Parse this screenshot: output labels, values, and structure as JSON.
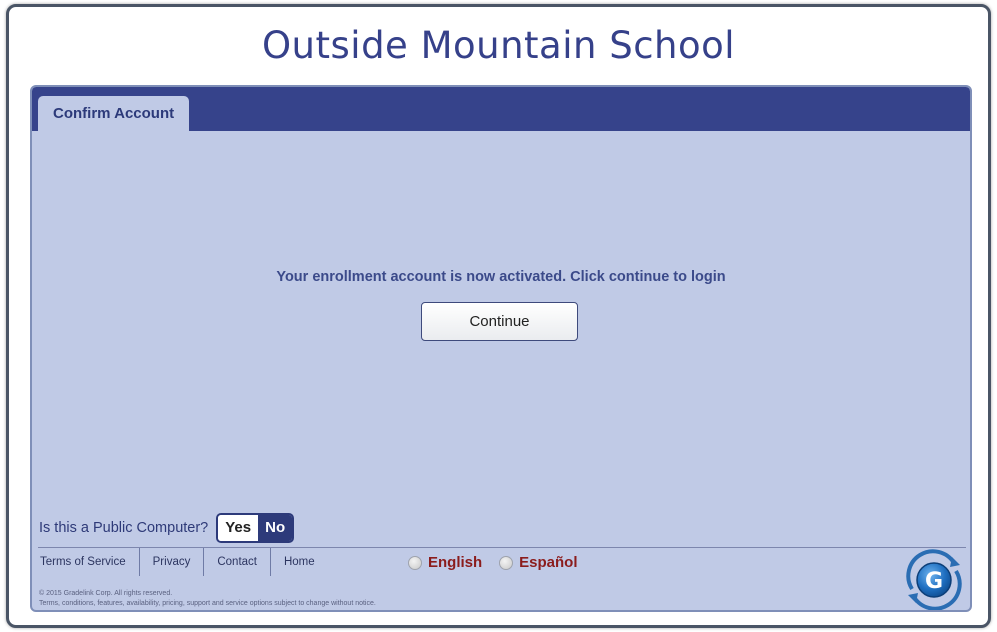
{
  "header": {
    "title": "Outside Mountain School"
  },
  "tabs": [
    {
      "label": "Confirm Account"
    }
  ],
  "main": {
    "message": "Your enrollment account is now activated. Click continue to login",
    "continue_label": "Continue"
  },
  "public_computer": {
    "question": "Is this a Public Computer?",
    "yes_label": "Yes",
    "no_label": "No",
    "selected": "No"
  },
  "footer": {
    "links": [
      "Terms of Service",
      "Privacy",
      "Contact",
      "Home"
    ],
    "languages": [
      "English",
      "Español"
    ],
    "copyright": "© 2015 Gradelink Corp. All rights reserved.",
    "disclaimer": "Terms, conditions, features, availability, pricing, support and service options subject to change without notice."
  },
  "colors": {
    "brand": "#36438b",
    "panel": "#c0cae6",
    "language_text": "#8b1c1c"
  },
  "icons": {
    "logo": "gradelink-g-logo"
  }
}
